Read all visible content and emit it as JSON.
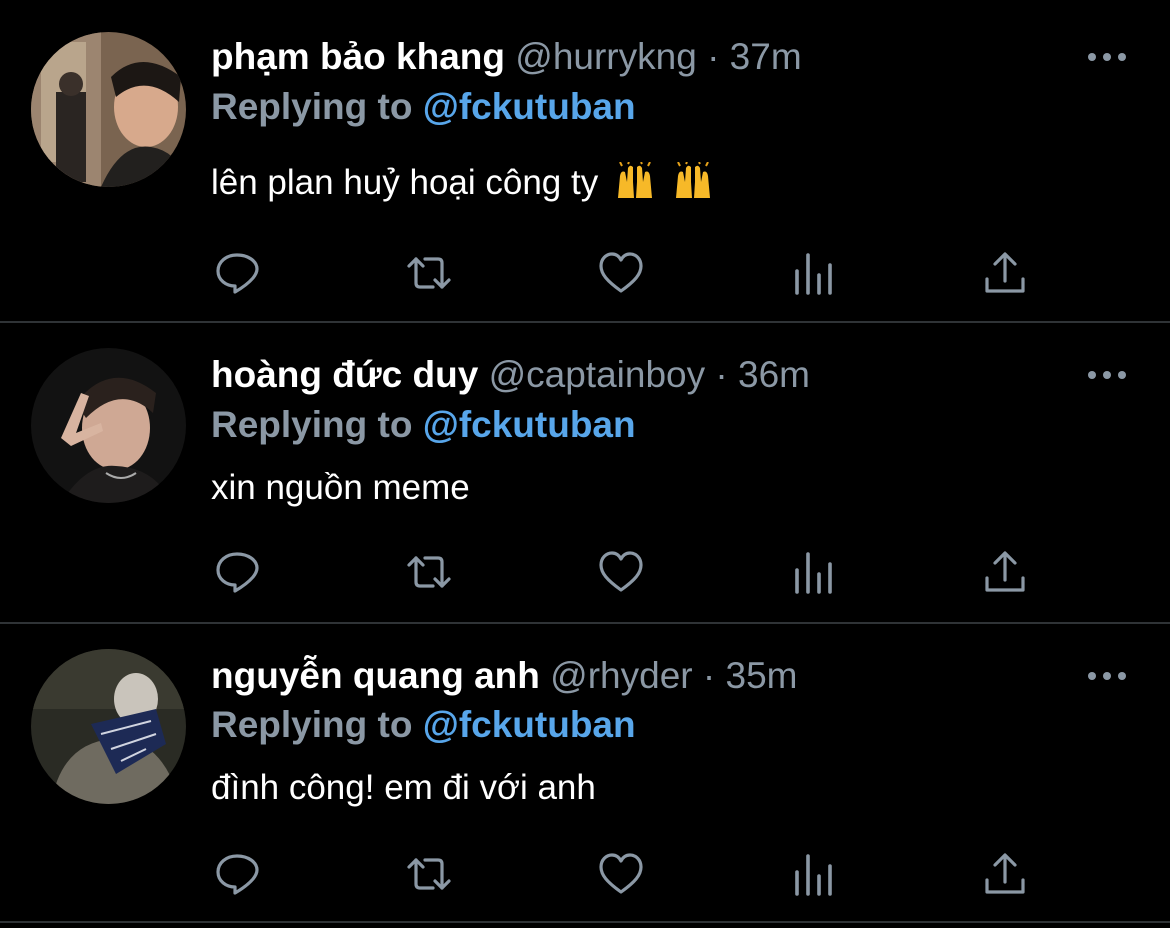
{
  "tweets": [
    {
      "name": "phạm bảo khang",
      "handle": "@hurrykng",
      "separator": "·",
      "time": "37m",
      "replying_prefix": "Replying to",
      "replying_to": "@fckutuban",
      "text": "lên plan huỷ hoại công ty",
      "emoji": [
        "raising-hands",
        "raising-hands"
      ]
    },
    {
      "name": "hoàng đức duy",
      "handle": "@captainboy",
      "separator": "·",
      "time": "36m",
      "replying_prefix": "Replying to",
      "replying_to": "@fckutuban",
      "text": "xin nguồn meme"
    },
    {
      "name": "nguyễn quang anh",
      "handle": "@rhyder",
      "separator": "·",
      "time": "35m",
      "replying_prefix": "Replying to",
      "replying_to": "@fckutuban",
      "text": "đình công! em đi với anh"
    }
  ],
  "icons": {
    "more": "more-icon",
    "reply": "reply-icon",
    "retweet": "retweet-icon",
    "like": "heart-icon",
    "views": "views-icon",
    "share": "share-icon"
  },
  "colors": {
    "background": "#000000",
    "name": "#ffffff",
    "secondary": "#8b98a5",
    "link": "#58a6ea",
    "icon": "#8b98a5",
    "divider": "#2f3336"
  }
}
